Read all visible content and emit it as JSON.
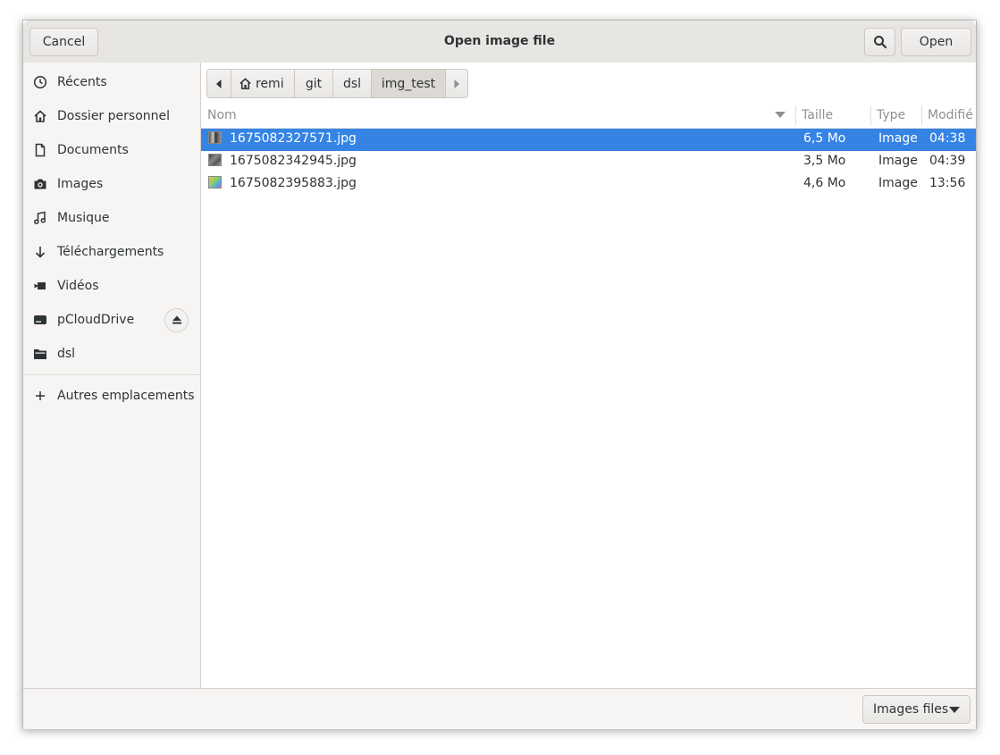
{
  "header": {
    "title": "Open image file",
    "cancel_label": "Cancel",
    "open_label": "Open",
    "search_icon": "search-icon"
  },
  "sidebar": {
    "items": [
      {
        "label": "Récents",
        "icon": "clock-icon"
      },
      {
        "label": "Dossier personnel",
        "icon": "home-icon"
      },
      {
        "label": "Documents",
        "icon": "document-icon"
      },
      {
        "label": "Images",
        "icon": "camera-icon"
      },
      {
        "label": "Musique",
        "icon": "music-icon"
      },
      {
        "label": "Téléchargements",
        "icon": "download-icon"
      },
      {
        "label": "Vidéos",
        "icon": "video-icon"
      },
      {
        "label": "pCloudDrive",
        "icon": "drive-icon"
      },
      {
        "label": "dsl",
        "icon": "folder-icon"
      }
    ],
    "other_locations": {
      "label": "Autres emplacements",
      "icon": "plus-icon"
    }
  },
  "pathbar": {
    "segments": [
      "remi",
      "git",
      "dsl",
      "img_test"
    ]
  },
  "columns": {
    "name": "Nom",
    "size": "Taille",
    "type": "Type",
    "modified": "Modifié"
  },
  "files": [
    {
      "name": "1675082327571.jpg",
      "size": "6,5 Mo",
      "type": "Image",
      "modified": "04:38",
      "selected": true
    },
    {
      "name": "1675082342945.jpg",
      "size": "3,5 Mo",
      "type": "Image",
      "modified": "04:39",
      "selected": false
    },
    {
      "name": "1675082395883.jpg",
      "size": "4,6 Mo",
      "type": "Image",
      "modified": "13:56",
      "selected": false
    }
  ],
  "footer": {
    "filter_label": "Images files"
  },
  "colors": {
    "selection": "#3584e4",
    "header_bg": "#e8e6e3",
    "sidebar_bg": "#f6f5f4"
  }
}
